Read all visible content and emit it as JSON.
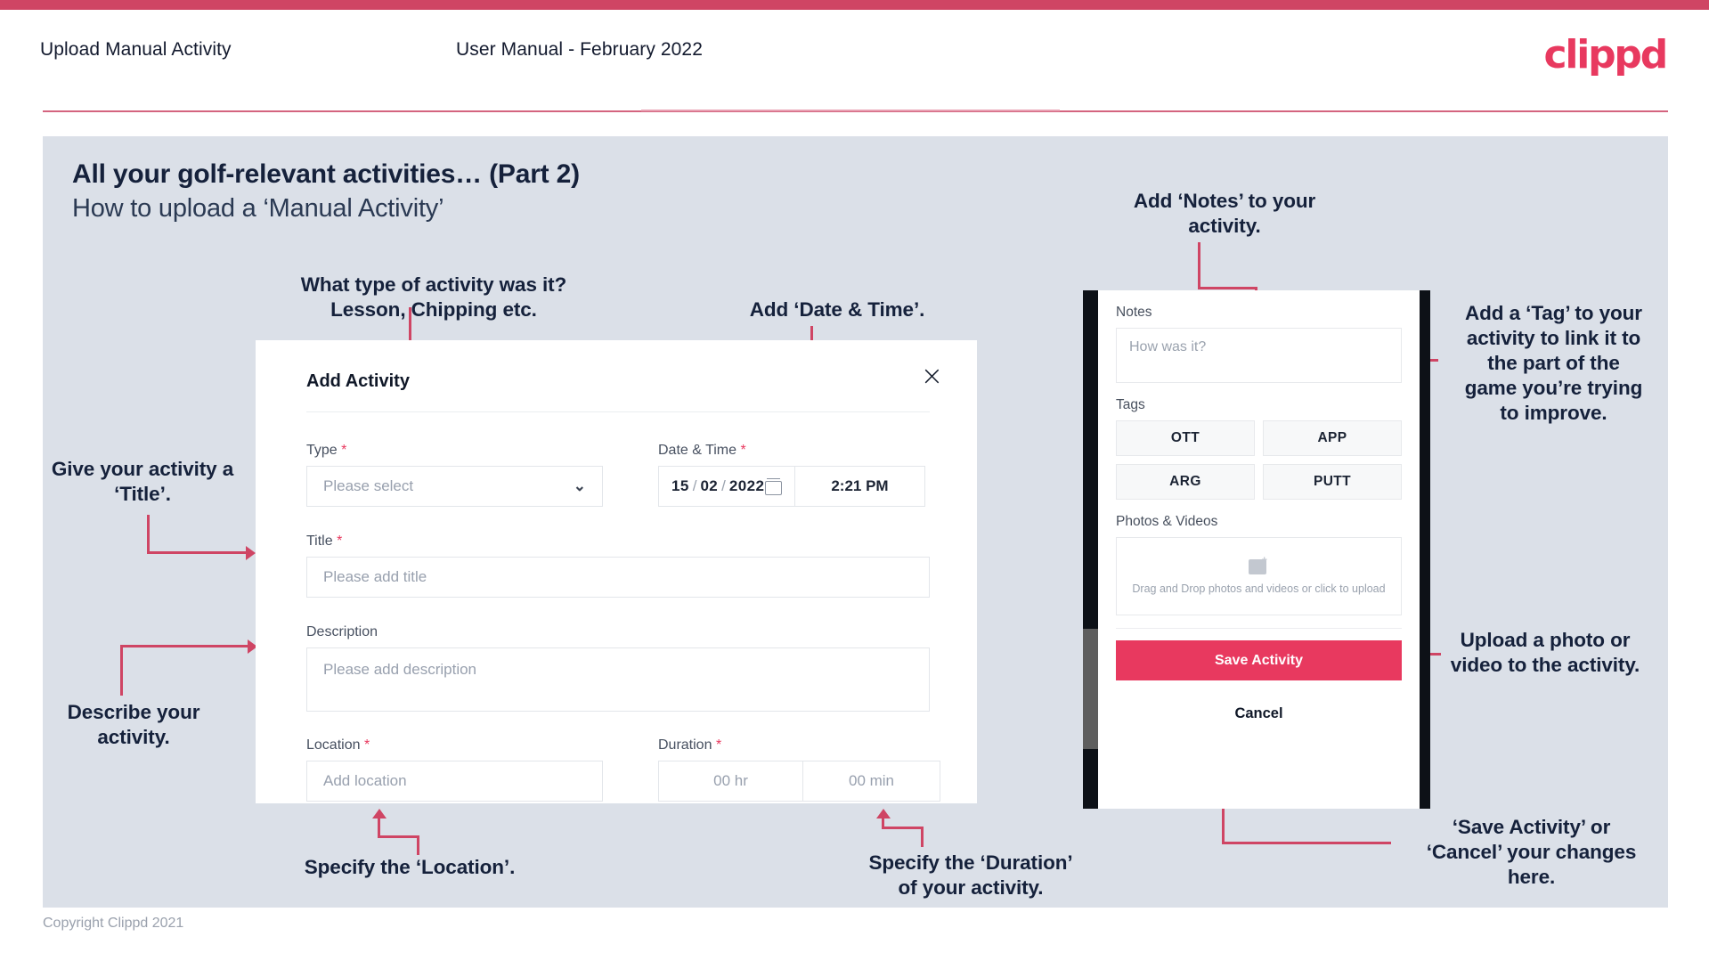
{
  "header": {
    "title": "Upload Manual Activity",
    "subtitle": "User Manual - February 2022",
    "logo": "clippd"
  },
  "slide": {
    "heading": "All your golf-relevant activities… (Part 2)",
    "subheading": "How to upload a ‘Manual Activity’",
    "copyright": "Copyright Clippd 2021"
  },
  "dialog": {
    "title": "Add Activity",
    "close_icon": "×",
    "fields": {
      "type": {
        "label": "Type",
        "required": "*",
        "placeholder": "Please select",
        "chevron": "⌄"
      },
      "datetime": {
        "label": "Date & Time",
        "required": "*",
        "day": "15",
        "month": "02",
        "year": "2022",
        "separator": "/",
        "time": "2:21 PM"
      },
      "title": {
        "label": "Title",
        "required": "*",
        "placeholder": "Please add title"
      },
      "description": {
        "label": "Description",
        "placeholder": "Please add description"
      },
      "location": {
        "label": "Location",
        "required": "*",
        "placeholder": "Add location"
      },
      "duration": {
        "label": "Duration",
        "required": "*",
        "hours": "00 hr",
        "minutes": "00 min"
      }
    }
  },
  "phone": {
    "notes_label": "Notes",
    "notes_placeholder": "How was it?",
    "tags_label": "Tags",
    "tags": [
      "OTT",
      "APP",
      "ARG",
      "PUTT"
    ],
    "photos_label": "Photos & Videos",
    "upload_text": "Drag and Drop photos and videos or click to upload",
    "save_label": "Save Activity",
    "cancel_label": "Cancel"
  },
  "annotations": {
    "type": "What type of activity was it?\nLesson, Chipping etc.",
    "datetime": "Add ‘Date & Time’.",
    "title": "Give your activity a\n‘Title’.",
    "description": "Describe your\nactivity.",
    "location": "Specify the ‘Location’.",
    "duration": "Specify the ‘Duration’\nof your activity.",
    "notes": "Add ‘Notes’ to your\nactivity.",
    "tags": "Add a ‘Tag’ to your\nactivity to link it to\nthe part of the\ngame you’re trying\nto improve.",
    "upload": "Upload a photo or\nvideo to the activity.",
    "save": "‘Save Activity’ or\n‘Cancel’ your changes\nhere."
  },
  "colors": {
    "accent": "#e8395f",
    "arrow": "#cf4564",
    "slide_bg": "#dbe0e8",
    "text_dark": "#15213b"
  }
}
